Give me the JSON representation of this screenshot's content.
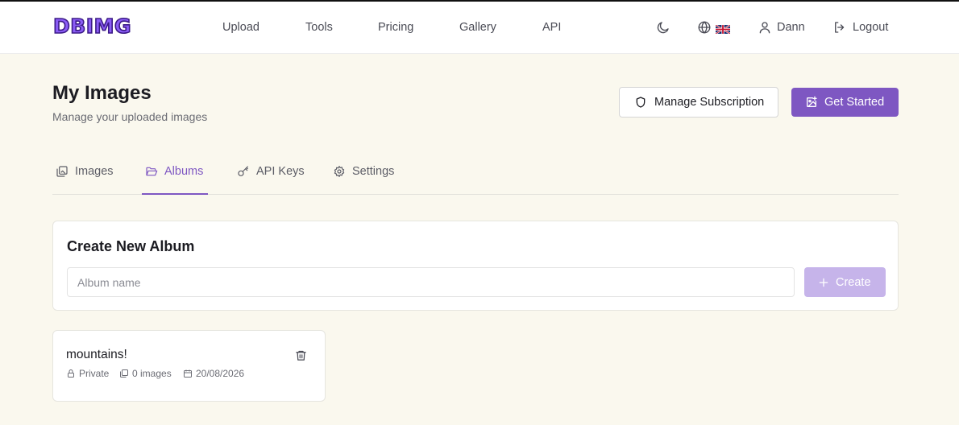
{
  "header": {
    "logo": "DBIMG",
    "nav": [
      "Upload",
      "Tools",
      "Pricing",
      "Gallery",
      "API"
    ],
    "user_name": "Dann",
    "logout_label": "Logout"
  },
  "page": {
    "title": "My Images",
    "subtitle": "Manage your uploaded images"
  },
  "actions": {
    "manage_subscription": "Manage Subscription",
    "get_started": "Get Started"
  },
  "tabs": [
    {
      "label": "Images",
      "active": false
    },
    {
      "label": "Albums",
      "active": true
    },
    {
      "label": "API Keys",
      "active": false
    },
    {
      "label": "Settings",
      "active": false
    }
  ],
  "create_album": {
    "title": "Create New Album",
    "placeholder": "Album name",
    "button_label": "Create"
  },
  "albums": [
    {
      "name": "mountains!",
      "privacy": "Private",
      "image_count": "0 images",
      "date": "20/08/2026"
    }
  ],
  "colors": {
    "accent": "#7e57c2",
    "accent_disabled": "#c6b4ea",
    "background": "#faf8ee"
  }
}
